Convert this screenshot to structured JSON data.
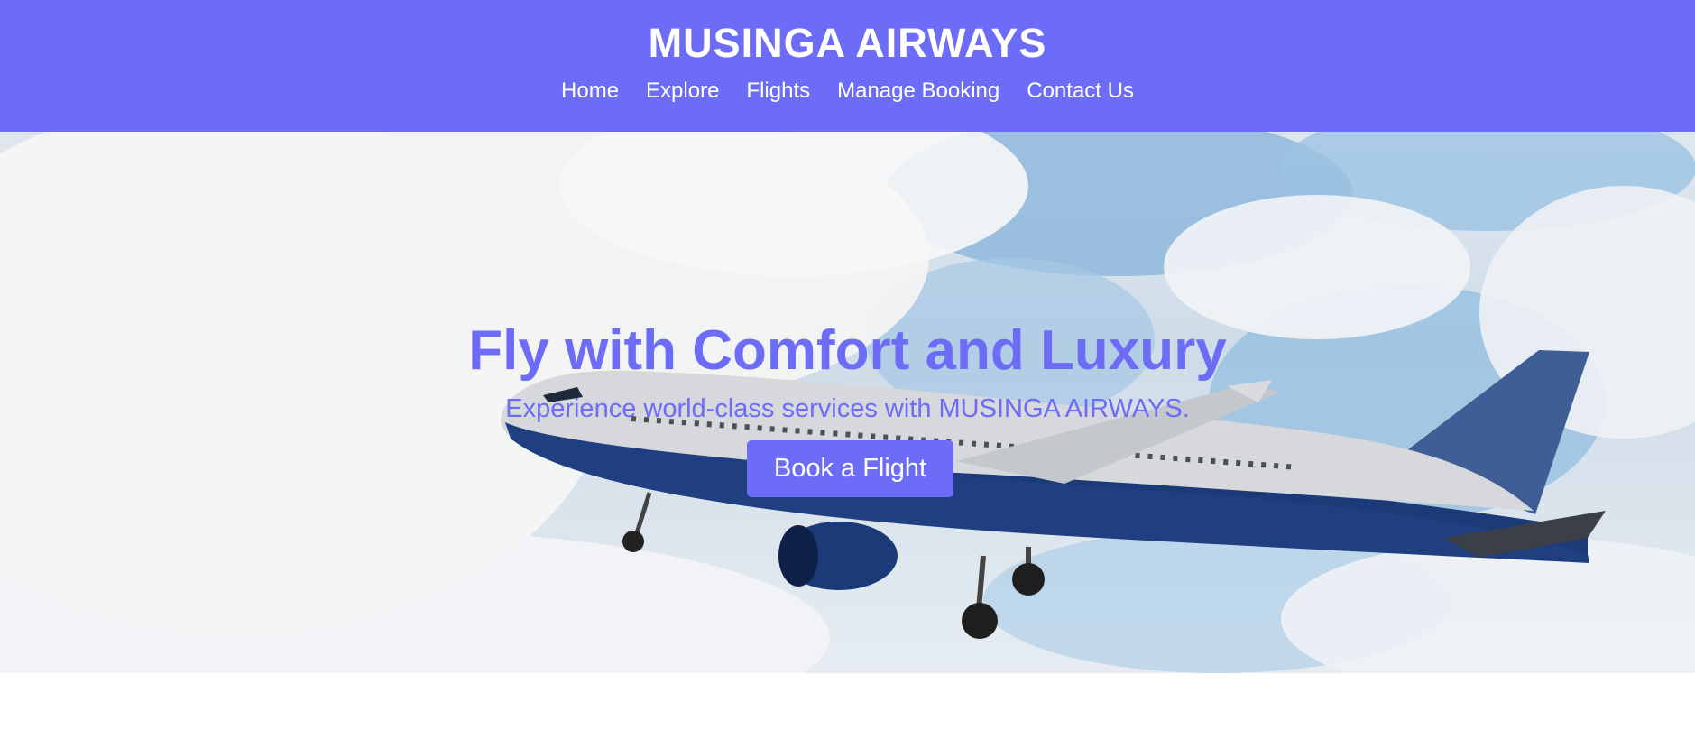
{
  "header": {
    "brand": "MUSINGA AIRWAYS",
    "nav": [
      "Home",
      "Explore",
      "Flights",
      "Manage Booking",
      "Contact Us"
    ]
  },
  "hero": {
    "title": "Fly with Comfort and Luxury",
    "subtitle": "Experience world-class services with MUSINGA AIRWAYS.",
    "cta_label": "Book a Flight",
    "background_image": "airplane-in-cloudy-sky"
  },
  "colors": {
    "accent": "#6c6cf7",
    "text_on_accent": "#ffffff",
    "page_background": "#ffffff"
  }
}
